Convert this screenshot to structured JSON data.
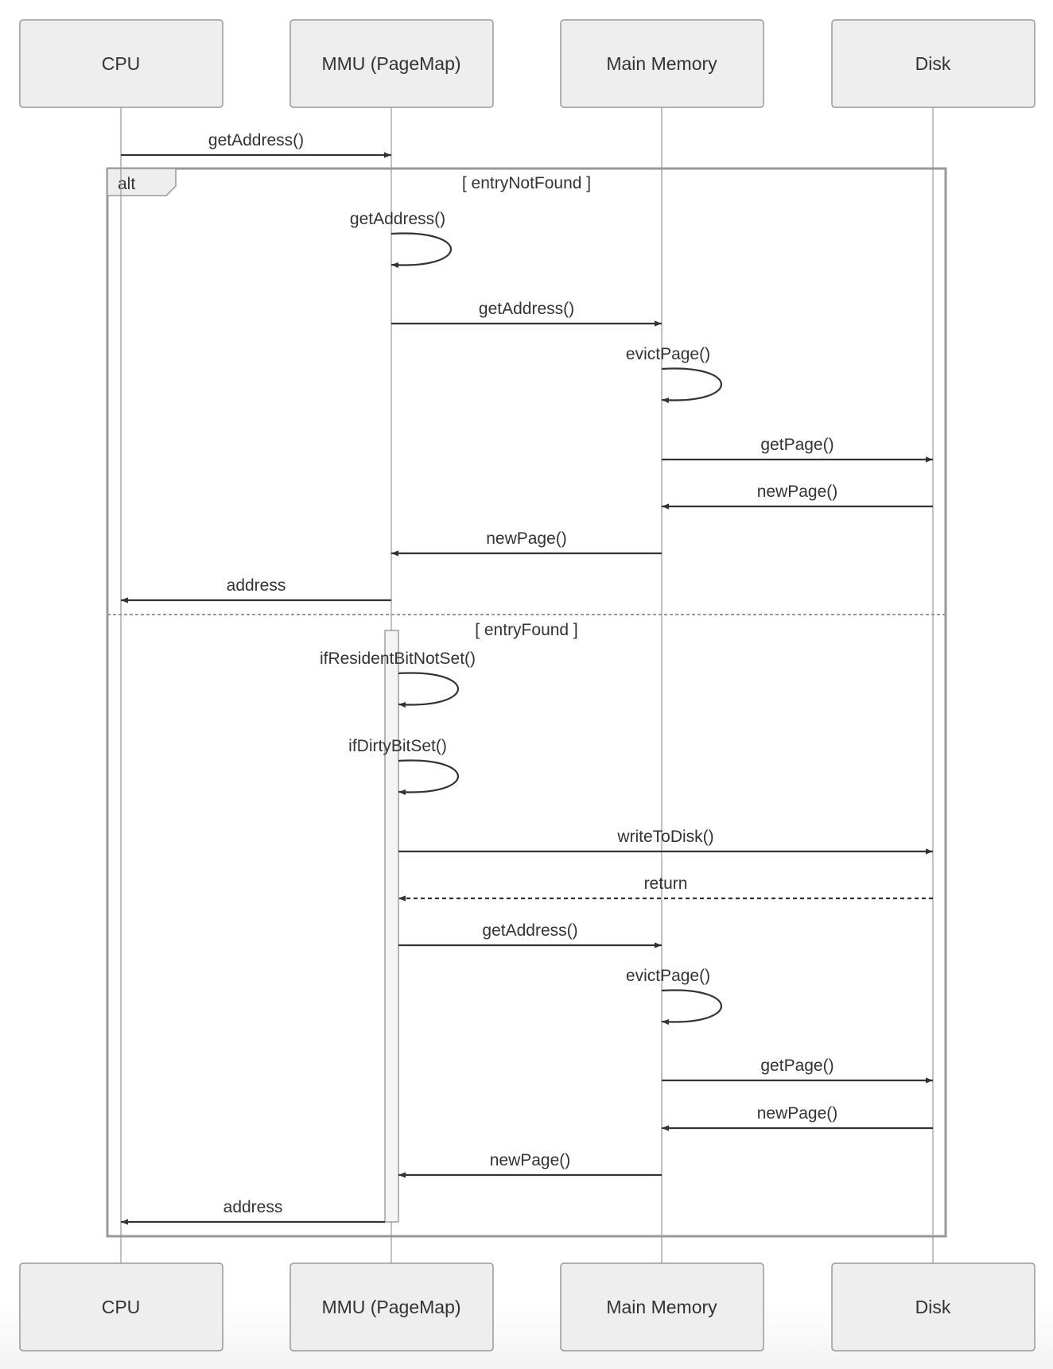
{
  "participants": [
    {
      "id": "cpu",
      "label": "CPU"
    },
    {
      "id": "mmu",
      "label": "MMU (PageMap)"
    },
    {
      "id": "mem",
      "label": "Main Memory"
    },
    {
      "id": "disk",
      "label": "Disk"
    }
  ],
  "messages": [
    {
      "from": "cpu",
      "to": "mmu",
      "label": "getAddress()",
      "style": "solid"
    },
    {
      "from": "mmu",
      "to": "mmu",
      "label": "getAddress()",
      "style": "solid"
    },
    {
      "from": "mmu",
      "to": "mem",
      "label": "getAddress()",
      "style": "solid"
    },
    {
      "from": "mem",
      "to": "mem",
      "label": "evictPage()",
      "style": "solid"
    },
    {
      "from": "mem",
      "to": "disk",
      "label": "getPage()",
      "style": "solid"
    },
    {
      "from": "disk",
      "to": "mem",
      "label": "newPage()",
      "style": "solid"
    },
    {
      "from": "mem",
      "to": "mmu",
      "label": "newPage()",
      "style": "solid"
    },
    {
      "from": "mmu",
      "to": "cpu",
      "label": "address",
      "style": "solid"
    },
    {
      "from": "mmu",
      "to": "mmu",
      "label": "ifResidentBitNotSet()",
      "style": "solid"
    },
    {
      "from": "mmu",
      "to": "mmu",
      "label": "ifDirtyBitSet()",
      "style": "solid"
    },
    {
      "from": "mmu",
      "to": "disk",
      "label": "writeToDisk()",
      "style": "solid"
    },
    {
      "from": "disk",
      "to": "mmu",
      "label": "return",
      "style": "dashed"
    },
    {
      "from": "mmu",
      "to": "mem",
      "label": "getAddress()",
      "style": "solid"
    },
    {
      "from": "mem",
      "to": "mem",
      "label": "evictPage()",
      "style": "solid"
    },
    {
      "from": "mem",
      "to": "disk",
      "label": "getPage()",
      "style": "solid"
    },
    {
      "from": "disk",
      "to": "mem",
      "label": "newPage()",
      "style": "solid"
    },
    {
      "from": "mem",
      "to": "mmu",
      "label": "newPage()",
      "style": "solid"
    },
    {
      "from": "mmu",
      "to": "cpu",
      "label": "address",
      "style": "solid"
    }
  ],
  "fragment": {
    "type": "alt",
    "sections": [
      {
        "condition": "[ entryNotFound ]"
      },
      {
        "condition": "[ entryFound ]"
      }
    ]
  },
  "colors": {
    "actor_fill": "#eeeeee",
    "actor_stroke": "#999999",
    "line": "#333333",
    "frame": "#999999"
  }
}
